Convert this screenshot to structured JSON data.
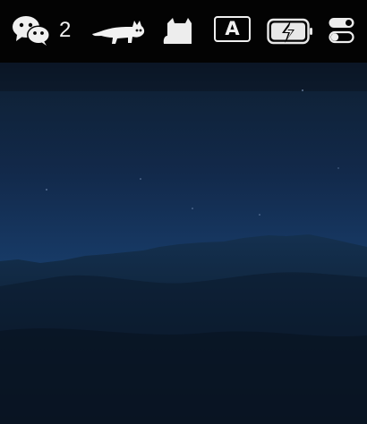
{
  "menubar": {
    "wechat": {
      "icon": "wechat-icon",
      "count": "2"
    },
    "app_icons": [
      "cat-silhouette-icon",
      "cat-ears-icon"
    ],
    "input_source": {
      "icon": "keyboard-input-icon",
      "label": "A"
    },
    "battery": {
      "icon": "battery-charging-icon"
    },
    "control_center": {
      "icon": "control-center-toggle-icon"
    },
    "colors": {
      "bar": "#030303",
      "glyph": "#f2f2f2"
    }
  },
  "desktop": {
    "wallpaper": "night-mountain-wallpaper",
    "colors": {
      "sky_top": "#0c1b2e",
      "sky_mid": "#173b66",
      "mountain": "#0f2237"
    }
  }
}
